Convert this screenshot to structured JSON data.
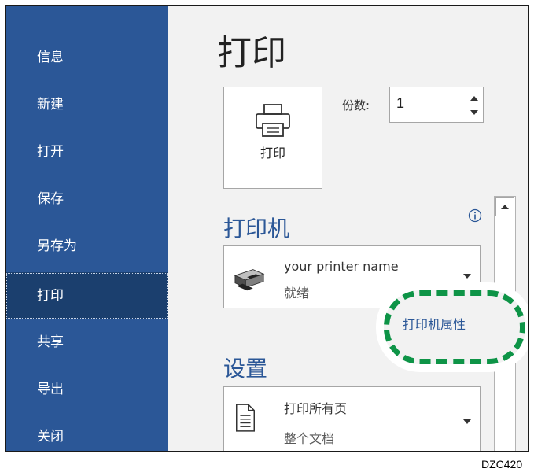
{
  "sidebar": {
    "items": [
      {
        "label": "信息"
      },
      {
        "label": "新建"
      },
      {
        "label": "打开"
      },
      {
        "label": "保存"
      },
      {
        "label": "另存为"
      },
      {
        "label": "打印",
        "active": true
      },
      {
        "label": "共享"
      },
      {
        "label": "导出"
      },
      {
        "label": "关闭"
      }
    ]
  },
  "main": {
    "title": "打印",
    "print_button": {
      "label": "打印",
      "icon": "printer-icon"
    },
    "copies": {
      "label": "份数:",
      "value": "1"
    },
    "printer_section": {
      "title": "打印机",
      "info_icon": "info-icon",
      "printer_name": "your printer name",
      "printer_status": "就绪",
      "properties_link": "打印机属性"
    },
    "settings_section": {
      "title": "设置",
      "line1": "打印所有页",
      "line2": "整个文档"
    }
  },
  "figure_code": "DZC420",
  "colors": {
    "sidebar": "#2b5797",
    "sidebar_active": "#1b3f6e",
    "accent": "#2b5797",
    "highlight": "#0e9447"
  }
}
